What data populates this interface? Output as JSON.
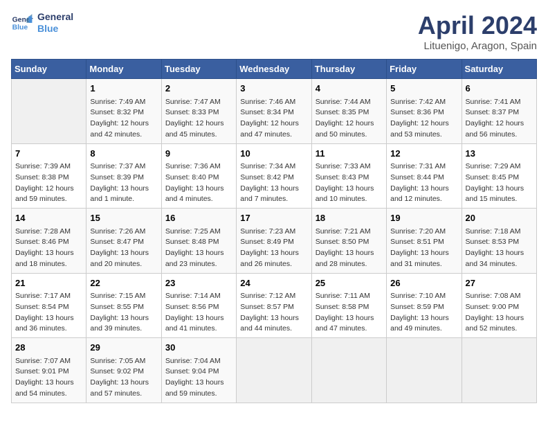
{
  "header": {
    "logo_line1": "General",
    "logo_line2": "Blue",
    "month_title": "April 2024",
    "location": "Lituenigo, Aragon, Spain"
  },
  "days_of_week": [
    "Sunday",
    "Monday",
    "Tuesday",
    "Wednesday",
    "Thursday",
    "Friday",
    "Saturday"
  ],
  "weeks": [
    [
      {
        "day": "",
        "info": ""
      },
      {
        "day": "1",
        "info": "Sunrise: 7:49 AM\nSunset: 8:32 PM\nDaylight: 12 hours\nand 42 minutes."
      },
      {
        "day": "2",
        "info": "Sunrise: 7:47 AM\nSunset: 8:33 PM\nDaylight: 12 hours\nand 45 minutes."
      },
      {
        "day": "3",
        "info": "Sunrise: 7:46 AM\nSunset: 8:34 PM\nDaylight: 12 hours\nand 47 minutes."
      },
      {
        "day": "4",
        "info": "Sunrise: 7:44 AM\nSunset: 8:35 PM\nDaylight: 12 hours\nand 50 minutes."
      },
      {
        "day": "5",
        "info": "Sunrise: 7:42 AM\nSunset: 8:36 PM\nDaylight: 12 hours\nand 53 minutes."
      },
      {
        "day": "6",
        "info": "Sunrise: 7:41 AM\nSunset: 8:37 PM\nDaylight: 12 hours\nand 56 minutes."
      }
    ],
    [
      {
        "day": "7",
        "info": "Sunrise: 7:39 AM\nSunset: 8:38 PM\nDaylight: 12 hours\nand 59 minutes."
      },
      {
        "day": "8",
        "info": "Sunrise: 7:37 AM\nSunset: 8:39 PM\nDaylight: 13 hours\nand 1 minute."
      },
      {
        "day": "9",
        "info": "Sunrise: 7:36 AM\nSunset: 8:40 PM\nDaylight: 13 hours\nand 4 minutes."
      },
      {
        "day": "10",
        "info": "Sunrise: 7:34 AM\nSunset: 8:42 PM\nDaylight: 13 hours\nand 7 minutes."
      },
      {
        "day": "11",
        "info": "Sunrise: 7:33 AM\nSunset: 8:43 PM\nDaylight: 13 hours\nand 10 minutes."
      },
      {
        "day": "12",
        "info": "Sunrise: 7:31 AM\nSunset: 8:44 PM\nDaylight: 13 hours\nand 12 minutes."
      },
      {
        "day": "13",
        "info": "Sunrise: 7:29 AM\nSunset: 8:45 PM\nDaylight: 13 hours\nand 15 minutes."
      }
    ],
    [
      {
        "day": "14",
        "info": "Sunrise: 7:28 AM\nSunset: 8:46 PM\nDaylight: 13 hours\nand 18 minutes."
      },
      {
        "day": "15",
        "info": "Sunrise: 7:26 AM\nSunset: 8:47 PM\nDaylight: 13 hours\nand 20 minutes."
      },
      {
        "day": "16",
        "info": "Sunrise: 7:25 AM\nSunset: 8:48 PM\nDaylight: 13 hours\nand 23 minutes."
      },
      {
        "day": "17",
        "info": "Sunrise: 7:23 AM\nSunset: 8:49 PM\nDaylight: 13 hours\nand 26 minutes."
      },
      {
        "day": "18",
        "info": "Sunrise: 7:21 AM\nSunset: 8:50 PM\nDaylight: 13 hours\nand 28 minutes."
      },
      {
        "day": "19",
        "info": "Sunrise: 7:20 AM\nSunset: 8:51 PM\nDaylight: 13 hours\nand 31 minutes."
      },
      {
        "day": "20",
        "info": "Sunrise: 7:18 AM\nSunset: 8:53 PM\nDaylight: 13 hours\nand 34 minutes."
      }
    ],
    [
      {
        "day": "21",
        "info": "Sunrise: 7:17 AM\nSunset: 8:54 PM\nDaylight: 13 hours\nand 36 minutes."
      },
      {
        "day": "22",
        "info": "Sunrise: 7:15 AM\nSunset: 8:55 PM\nDaylight: 13 hours\nand 39 minutes."
      },
      {
        "day": "23",
        "info": "Sunrise: 7:14 AM\nSunset: 8:56 PM\nDaylight: 13 hours\nand 41 minutes."
      },
      {
        "day": "24",
        "info": "Sunrise: 7:12 AM\nSunset: 8:57 PM\nDaylight: 13 hours\nand 44 minutes."
      },
      {
        "day": "25",
        "info": "Sunrise: 7:11 AM\nSunset: 8:58 PM\nDaylight: 13 hours\nand 47 minutes."
      },
      {
        "day": "26",
        "info": "Sunrise: 7:10 AM\nSunset: 8:59 PM\nDaylight: 13 hours\nand 49 minutes."
      },
      {
        "day": "27",
        "info": "Sunrise: 7:08 AM\nSunset: 9:00 PM\nDaylight: 13 hours\nand 52 minutes."
      }
    ],
    [
      {
        "day": "28",
        "info": "Sunrise: 7:07 AM\nSunset: 9:01 PM\nDaylight: 13 hours\nand 54 minutes."
      },
      {
        "day": "29",
        "info": "Sunrise: 7:05 AM\nSunset: 9:02 PM\nDaylight: 13 hours\nand 57 minutes."
      },
      {
        "day": "30",
        "info": "Sunrise: 7:04 AM\nSunset: 9:04 PM\nDaylight: 13 hours\nand 59 minutes."
      },
      {
        "day": "",
        "info": ""
      },
      {
        "day": "",
        "info": ""
      },
      {
        "day": "",
        "info": ""
      },
      {
        "day": "",
        "info": ""
      }
    ]
  ]
}
